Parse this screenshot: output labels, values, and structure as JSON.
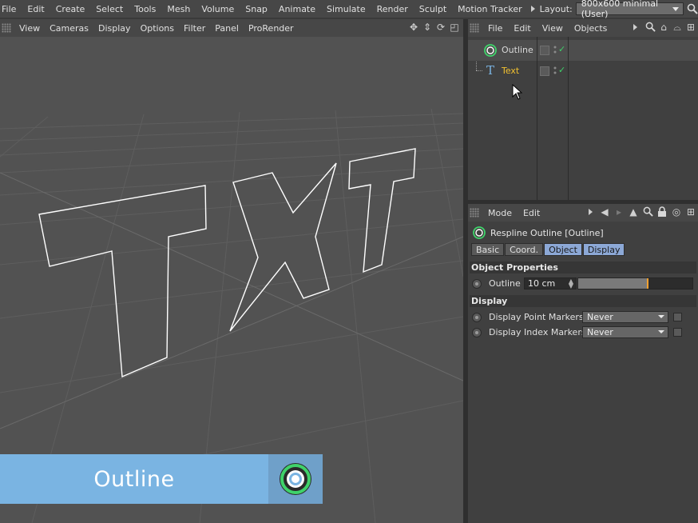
{
  "menubar": {
    "items": [
      "File",
      "Edit",
      "Create",
      "Select",
      "Tools",
      "Mesh",
      "Volume",
      "Snap",
      "Animate",
      "Simulate",
      "Render",
      "Sculpt",
      "Motion Tracker"
    ],
    "layout_label": "Layout:",
    "layout_value": "800x600 minimal (User)",
    "search_icon": "search-icon"
  },
  "viewport_menu": {
    "items": [
      "View",
      "Cameras",
      "Display",
      "Options",
      "Filter",
      "Panel",
      "ProRender"
    ],
    "icons": [
      "move-icon",
      "arrows-icon",
      "rotate-icon",
      "maximize-icon"
    ]
  },
  "viewport": {
    "scene_text": "TXT",
    "background": "#525252",
    "outline_color": "#ffffff"
  },
  "object_manager": {
    "menu": [
      "File",
      "Edit",
      "View",
      "Objects"
    ],
    "objects": [
      {
        "name": "Outline",
        "icon": "respline-outline-icon",
        "color": "#d8d8d8",
        "selected": true
      },
      {
        "name": "Text",
        "icon": "text-spline-icon",
        "color": "#f0c030",
        "selected": false
      }
    ]
  },
  "attribute_manager": {
    "menu": [
      "Mode",
      "Edit"
    ],
    "title": "Respline Outline [Outline]",
    "tabs": [
      {
        "label": "Basic",
        "active": false
      },
      {
        "label": "Coord.",
        "active": false
      },
      {
        "label": "Object",
        "active": true
      },
      {
        "label": "Display",
        "active": true
      }
    ],
    "sections": {
      "object_properties": "Object Properties",
      "display": "Display"
    },
    "outline": {
      "label": "Outline",
      "value": "10 cm",
      "slider_fraction": 0.6
    },
    "display_point_markers": {
      "label": "Display Point Markers",
      "value": "Never"
    },
    "display_index_markers": {
      "label": "Display Index Markers",
      "value": "Never"
    }
  },
  "lower_third": {
    "label": "Outline",
    "background": "#7ab4e2",
    "icon": "respline-outline-icon"
  },
  "colors": {
    "accent_green": "#3fd26a",
    "text_object": "#f0c030",
    "tab_active": "#8ca8d6",
    "slider_knob": "#f0a030"
  }
}
